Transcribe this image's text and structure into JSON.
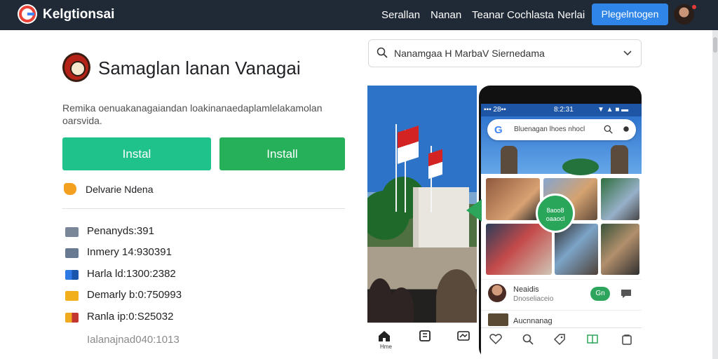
{
  "topbar": {
    "app_name": "Kelgtionsai",
    "nav": [
      "Serallan",
      "Nanan",
      "Teanar Cochlasta",
      "Nerlai"
    ],
    "cta": "Plegelntogen"
  },
  "app": {
    "title": "Samaglan lanan Vanagai",
    "description": "Remika oenuakanagaiandan loakinanaedaplamlelakamolan oarsvida.",
    "install_primary": "Instal",
    "install_secondary": "Install",
    "developer": "Delvarie Ndena"
  },
  "stats": [
    "Penanyds:391",
    "Inmery 14:930391",
    "Harla ld:1300:2382",
    "Demarly b:0:750993",
    "Ranla ip:0:S25032"
  ],
  "stats_muted": "Ialanajnad040:1013",
  "search": {
    "value": "Nanamgaa H MarbaV Siernedama"
  },
  "panel": {
    "home_label": "Hme"
  },
  "phone": {
    "status_left": "▪▪▪ 28▪▪",
    "status_time": "8:2:31",
    "status_icons": "▼ ▲ ■ ▬",
    "search_text": "Bluenagan lhoes nhocl",
    "badge_text": "8aoo8 oaaocl",
    "list_title": "Neaidis",
    "list_sub": "Dnoseliaceio",
    "list_badge": "Gn",
    "list_row2_title": "Aucnnanag"
  },
  "colors": {
    "topbar": "#1f2a36",
    "primary_button": "#20c28b",
    "secondary_button": "#26b05a",
    "cta": "#2f86e8"
  }
}
